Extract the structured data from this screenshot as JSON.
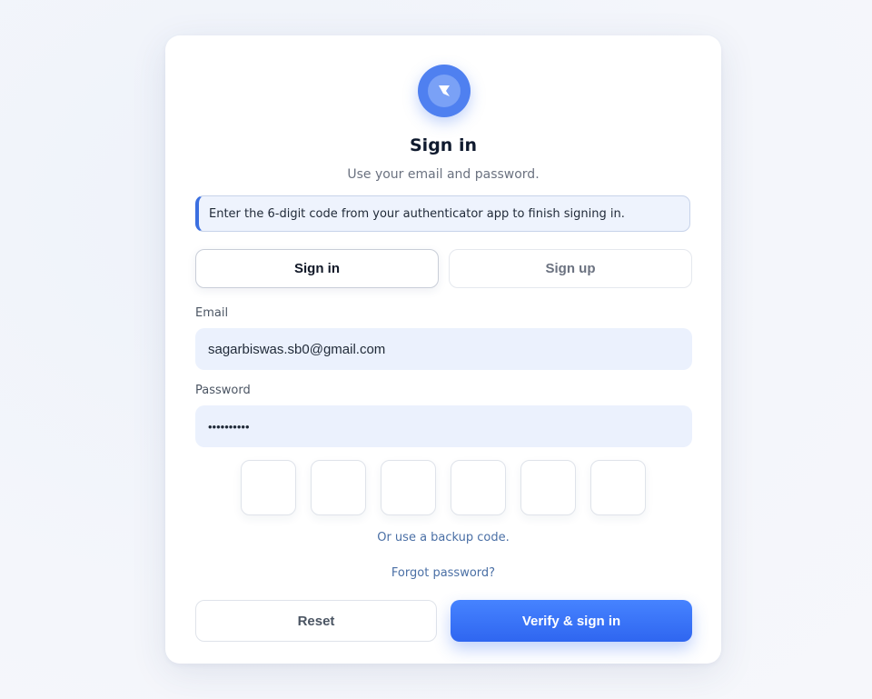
{
  "header": {
    "title": "Sign in",
    "subtitle": "Use your email and password."
  },
  "notice": {
    "text": "Enter the 6-digit code from your authenticator app to finish signing in."
  },
  "tabs": [
    {
      "label": "Sign in",
      "active": true
    },
    {
      "label": "Sign up",
      "active": false
    }
  ],
  "form": {
    "email_label": "Email",
    "email_value": "sagarbiswas.sb0@gmail.com",
    "password_label": "Password",
    "password_value": "••••••••••",
    "otp_digits": [
      "",
      "",
      "",
      "",
      "",
      ""
    ]
  },
  "links": {
    "backup_code": "Or use a backup code.",
    "forgot_password": "Forgot password?"
  },
  "actions": {
    "reset_label": "Reset",
    "verify_label": "Verify & sign in"
  },
  "colors": {
    "accent": "#2f66f0",
    "link": "#4a6fa5",
    "input_bg": "#ebf1fd"
  },
  "icons": {
    "logo": "bookmark-flag-icon"
  }
}
